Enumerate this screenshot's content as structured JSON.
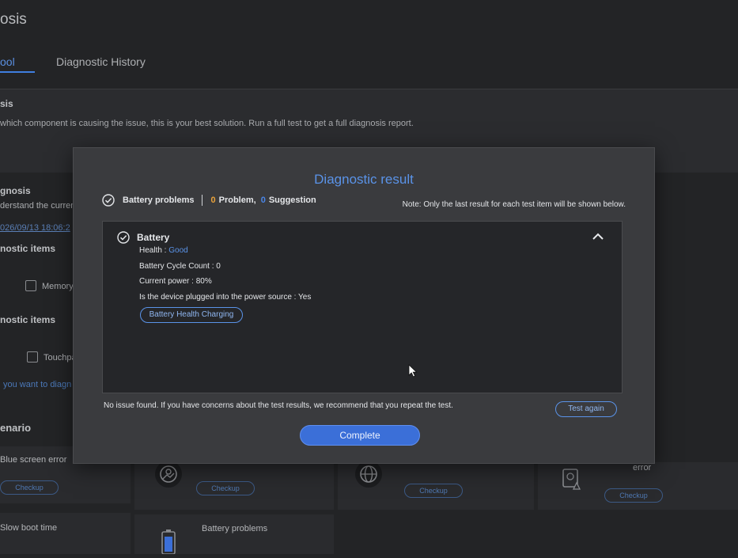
{
  "background": {
    "page_title": "osis",
    "tabs": [
      {
        "label": "ool",
        "active": true
      },
      {
        "label": "Diagnostic History",
        "active": false
      }
    ],
    "full_test": {
      "heading": "sis",
      "description": "which component is causing the issue, this is your best solution. Run a full test to get a full diagnosis report."
    },
    "quick": {
      "heading": "gnosis",
      "description": "derstand the current H",
      "timestamp": "026/09/13 18:06:2"
    },
    "group1": {
      "heading": "nostic items",
      "checkbox_label": "Memory"
    },
    "group2": {
      "heading": "nostic items",
      "checkbox_label": "Touchpa"
    },
    "link_text": "you want to diagn",
    "scenario": {
      "heading": "enario",
      "checkup_label": "Checkup",
      "items": [
        "Blue screen error",
        "error",
        "Slow boot time",
        "Battery problems"
      ]
    }
  },
  "dialog": {
    "title": "Diagnostic result",
    "summary": {
      "category": "Battery problems",
      "problem_count": "0",
      "problem_label": "Problem,",
      "suggestion_count": "0",
      "suggestion_label": "Suggestion"
    },
    "note": "Note: Only the last result for each test item will be shown below.",
    "section": {
      "title": "Battery",
      "health_label": "Health :",
      "health_value": "Good",
      "cycle_count": "Battery Cycle Count : 0",
      "current_power": "Current power : 80%",
      "plugged": "Is the device plugged into the power source : Yes",
      "button_label": "Battery Health Charging"
    },
    "no_issue_text": "No issue found. If you have concerns about the test results, we recommend that you repeat the test.",
    "test_again_label": "Test again",
    "complete_label": "Complete"
  },
  "colors": {
    "accent": "#5a93e8",
    "primary_button": "#3b6fd8",
    "warning_number": "#e9a23b",
    "dialog_bg": "#3a3b3e",
    "panel_bg": "#252629"
  },
  "icons": [
    "check-circle-icon",
    "chevron-up-icon",
    "mouse-cursor-icon",
    "photo-icon",
    "globe-icon",
    "drive-warning-icon",
    "battery-icon"
  ]
}
